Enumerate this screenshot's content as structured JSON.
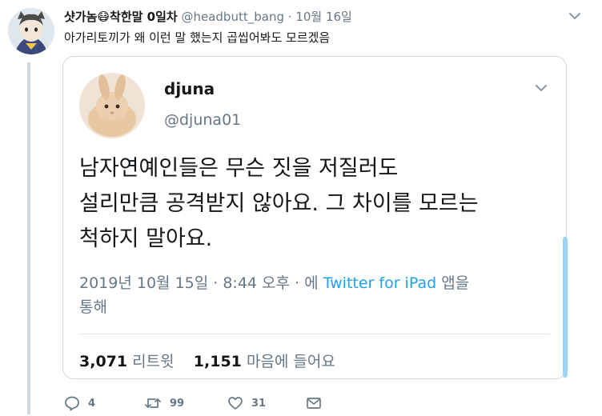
{
  "tweet": {
    "display_name": "샷가놈😷착한말 0일차",
    "handle": "@headbutt_bang",
    "separator": "·",
    "date": "10월 16일",
    "text": "아가리토끼가 왜 이런 말 했는지 곱씹어봐도 모르겠음"
  },
  "quoted": {
    "name": "djuna",
    "handle": "@djuna01",
    "text_lines": [
      "남자연예인들은 무슨 짓을 저질러도",
      "설리만큼 공격받지 않아요. 그 차이를 모르는",
      "척하지 말아요."
    ],
    "timestamp": "2019년 10월 15일 · 8:44 오후 · 에",
    "client": "Twitter for iPad",
    "client_suffix": "앱을",
    "client_suffix2": "통해",
    "retweet_count": "3,071",
    "retweet_label": "리트윗",
    "like_count": "1,151",
    "like_label": "마음에 들어요"
  },
  "actions": {
    "reply_count": "4",
    "retweet_count": "99",
    "like_count": "31"
  },
  "colors": {
    "link": "#1da1f2",
    "secondary": "#657786",
    "border": "#cfd9de"
  }
}
